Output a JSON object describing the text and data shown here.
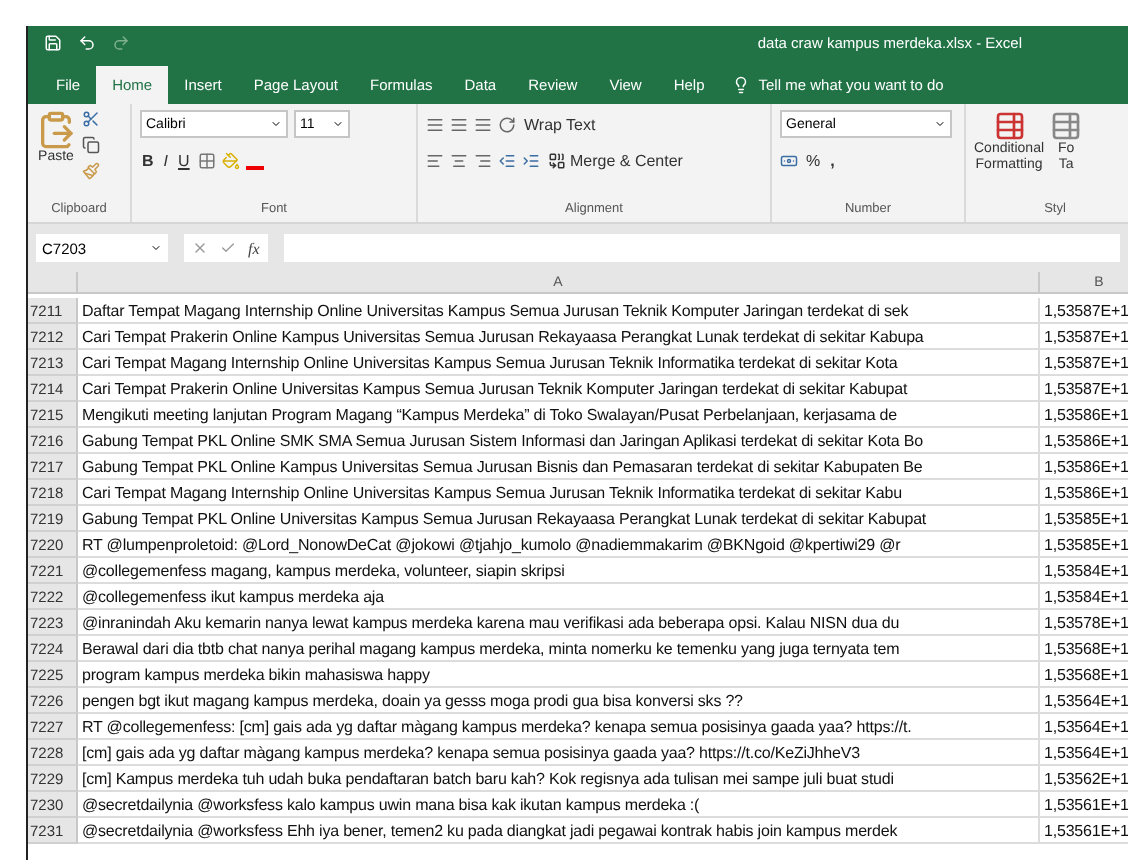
{
  "window": {
    "title": "data craw kampus merdeka.xlsx  -  Excel"
  },
  "tabs": [
    {
      "label": "File",
      "selected": false
    },
    {
      "label": "Home",
      "selected": true
    },
    {
      "label": "Insert",
      "selected": false
    },
    {
      "label": "Page Layout",
      "selected": false
    },
    {
      "label": "Formulas",
      "selected": false
    },
    {
      "label": "Data",
      "selected": false
    },
    {
      "label": "Review",
      "selected": false
    },
    {
      "label": "View",
      "selected": false
    },
    {
      "label": "Help",
      "selected": false
    }
  ],
  "tell_me": {
    "placeholder": "Tell me what you want to do"
  },
  "ribbon": {
    "paste": "Paste",
    "font_name": "Calibri",
    "font_size": "11",
    "bold": "B",
    "italic": "I",
    "underline": "U",
    "wrap_text": "Wrap Text",
    "merge_center": "Merge & Center",
    "number_format": "General",
    "percent": "%",
    "comma": ",",
    "conditional_formatting": [
      "Conditional",
      "Formatting"
    ],
    "format_table": [
      "Fo",
      "Ta"
    ],
    "groups": [
      "Clipboard",
      "Font",
      "Alignment",
      "Number",
      "Styl"
    ]
  },
  "formula_bar": {
    "name_box": "C7203",
    "fx": "fx"
  },
  "columns": [
    "A",
    "B"
  ],
  "rows": [
    {
      "num": "7211",
      "a": "Daftar Tempat Magang Internship Online Universitas Kampus Semua Jurusan Teknik Komputer Jaringan terdekat di sek",
      "b": "1,53587E+1"
    },
    {
      "num": "7212",
      "a": "Cari Tempat Prakerin Online Kampus Universitas Semua Jurusan Rekayaasa Perangkat Lunak terdekat di sekitar Kabupa",
      "b": "1,53587E+1"
    },
    {
      "num": "7213",
      "a": "Cari Tempat Magang Internship Online Universitas Kampus Semua Jurusan Teknik Informatika terdekat di sekitar Kota",
      "b": "1,53587E+1"
    },
    {
      "num": "7214",
      "a": "Cari Tempat Prakerin Online Universitas Kampus Semua Jurusan Teknik Komputer Jaringan terdekat di sekitar Kabupat",
      "b": "1,53587E+1"
    },
    {
      "num": "7215",
      "a": "Mengikuti meeting lanjutan Program Magang “Kampus Merdeka” di Toko Swalayan/Pusat Perbelanjaan, kerjasama de",
      "b": "1,53586E+1"
    },
    {
      "num": "7216",
      "a": "Gabung Tempat PKL Online SMK SMA Semua Jurusan Sistem Informasi dan Jaringan Aplikasi terdekat di sekitar Kota Bo",
      "b": "1,53586E+1"
    },
    {
      "num": "7217",
      "a": "Gabung Tempat PKL Online Kampus Universitas Semua Jurusan Bisnis dan Pemasaran terdekat di sekitar Kabupaten Be",
      "b": "1,53586E+1"
    },
    {
      "num": "7218",
      "a": "Cari Tempat Magang Internship Online Universitas Kampus Semua Jurusan Teknik Informatika terdekat di sekitar Kabu",
      "b": "1,53586E+1"
    },
    {
      "num": "7219",
      "a": "Gabung Tempat PKL Online Universitas Kampus Semua Jurusan Rekayaasa Perangkat Lunak terdekat di sekitar Kabupat",
      "b": "1,53585E+1"
    },
    {
      "num": "7220",
      "a": "RT @lumpenproletoid: @Lord_NonowDeCat @jokowi @tjahjo_kumolo @nadiemmakarim @BKNgoid @kpertiwi29 @r",
      "b": "1,53585E+1"
    },
    {
      "num": "7221",
      "a": "@collegemenfess magang, kampus merdeka, volunteer, siapin skripsi",
      "b": "1,53584E+1"
    },
    {
      "num": "7222",
      "a": "@collegemenfess ikut kampus merdeka aja",
      "b": "1,53584E+1"
    },
    {
      "num": "7223",
      "a": "@inranindah Aku kemarin nanya lewat kampus merdeka karena mau verifikasi ada beberapa opsi. Kalau NISN dua du",
      "b": "1,53578E+1"
    },
    {
      "num": "7224",
      "a": "Berawal dari dia tbtb chat nanya perihal magang kampus merdeka, minta nomerku ke temenku yang juga ternyata tem",
      "b": "1,53568E+1"
    },
    {
      "num": "7225",
      "a": "program kampus merdeka bikin mahasiswa happy",
      "b": "1,53568E+1"
    },
    {
      "num": "7226",
      "a": "pengen bgt ikut magang kampus merdeka, doain ya gesss moga prodi gua bisa konversi sks ??",
      "b": "1,53564E+1"
    },
    {
      "num": "7227",
      "a": "RT @collegemenfess: [cm] gais ada yg daftar màgang kampus merdeka? kenapa semua posisinya gaada yaa? https://t.",
      "b": "1,53564E+1"
    },
    {
      "num": "7228",
      "a": "[cm] gais ada yg daftar màgang kampus merdeka? kenapa semua posisinya gaada yaa? https://t.co/KeZiJhheV3",
      "b": "1,53564E+1"
    },
    {
      "num": "7229",
      "a": "[cm] Kampus merdeka tuh udah buka pendaftaran batch baru kah? Kok regisnya ada tulisan mei sampe juli buat studi",
      "b": "1,53562E+1"
    },
    {
      "num": "7230",
      "a": "@secretdailynia @worksfess kalo kampus uwin mana bisa kak ikutan kampus merdeka :(",
      "b": "1,53561E+1"
    },
    {
      "num": "7231",
      "a": "@secretdailynia @worksfess Ehh iya bener, temen2 ku pada diangkat jadi pegawai kontrak habis join kampus merdek",
      "b": "1,53561E+1"
    }
  ]
}
